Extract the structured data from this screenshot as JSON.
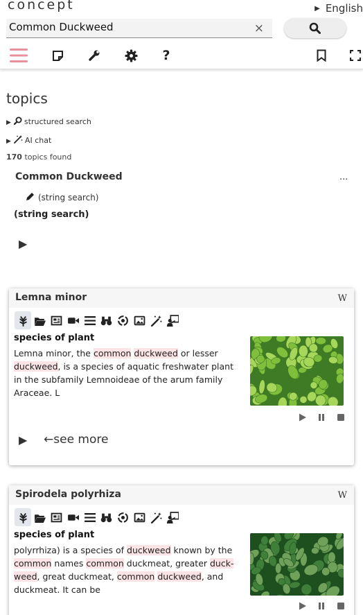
{
  "app": {
    "logo": "concept"
  },
  "language": {
    "label": "English"
  },
  "search": {
    "value": "Common Duckweed",
    "clear_glyph": "×"
  },
  "toolbar": {
    "icons": [
      "menu-icon",
      "sticky-note-icon",
      "wrench-icon",
      "gear-icon",
      "help-icon",
      "bookmark-icon",
      "fullscreen-icon"
    ],
    "accent": "#e8909c"
  },
  "topics": {
    "heading": "topics",
    "structured_search": "structured search",
    "ai_chat": "AI chat",
    "count": "170",
    "found_suffix": " topics found",
    "query_title": "Common Duckweed",
    "more": "...",
    "string_search_small": "(string search)",
    "string_search": "(string search)"
  },
  "cards": [
    {
      "title": "Lemna minor",
      "wiki": "W",
      "description_heading": "species of plant",
      "description_parts": [
        {
          "t": "Lemna minor, the ",
          "h": false
        },
        {
          "t": "common",
          "h": true
        },
        {
          "t": " ",
          "h": false
        },
        {
          "t": "duckweed",
          "h": true
        },
        {
          "t": " or lesser ",
          "h": false
        },
        {
          "t": "duckweed",
          "h": true
        },
        {
          "t": ", is a species of aquatic freshwater plant in the subfamily Lemnoideae of the arum family Araceae. L",
          "h": false
        }
      ],
      "see_more": "see more",
      "image_colors": [
        "#3f7a24",
        "#7fbf3c",
        "#a6d65a"
      ]
    },
    {
      "title": "Spirodela polyrhiza",
      "wiki": "W",
      "description_heading": "species of plant",
      "description_parts": [
        {
          "t": "polyrrhiza) is a species of ",
          "h": false
        },
        {
          "t": "duckweed",
          "h": true
        },
        {
          "t": " known by the ",
          "h": false
        },
        {
          "t": "common",
          "h": true
        },
        {
          "t": " names ",
          "h": false
        },
        {
          "t": "common",
          "h": true
        },
        {
          "t": " duckmeat, greater ",
          "h": false
        },
        {
          "t": "duck-weed",
          "h": true
        },
        {
          "t": ", great duckmeat, ",
          "h": false
        },
        {
          "t": "common",
          "h": true
        },
        {
          "t": " ",
          "h": false
        },
        {
          "t": "duckweed",
          "h": true
        },
        {
          "t": ", and duckmeat. It can be",
          "h": false
        }
      ],
      "image_colors": [
        "#1e4f1e",
        "#3f7f3a",
        "#6fa15a"
      ]
    }
  ],
  "card_icons": [
    "leaf-icon",
    "folder-open-icon",
    "newspaper-icon",
    "video-icon",
    "list-icon",
    "binoculars-icon",
    "atom-icon",
    "image-icon",
    "magic-wand-icon",
    "teacher-icon"
  ]
}
